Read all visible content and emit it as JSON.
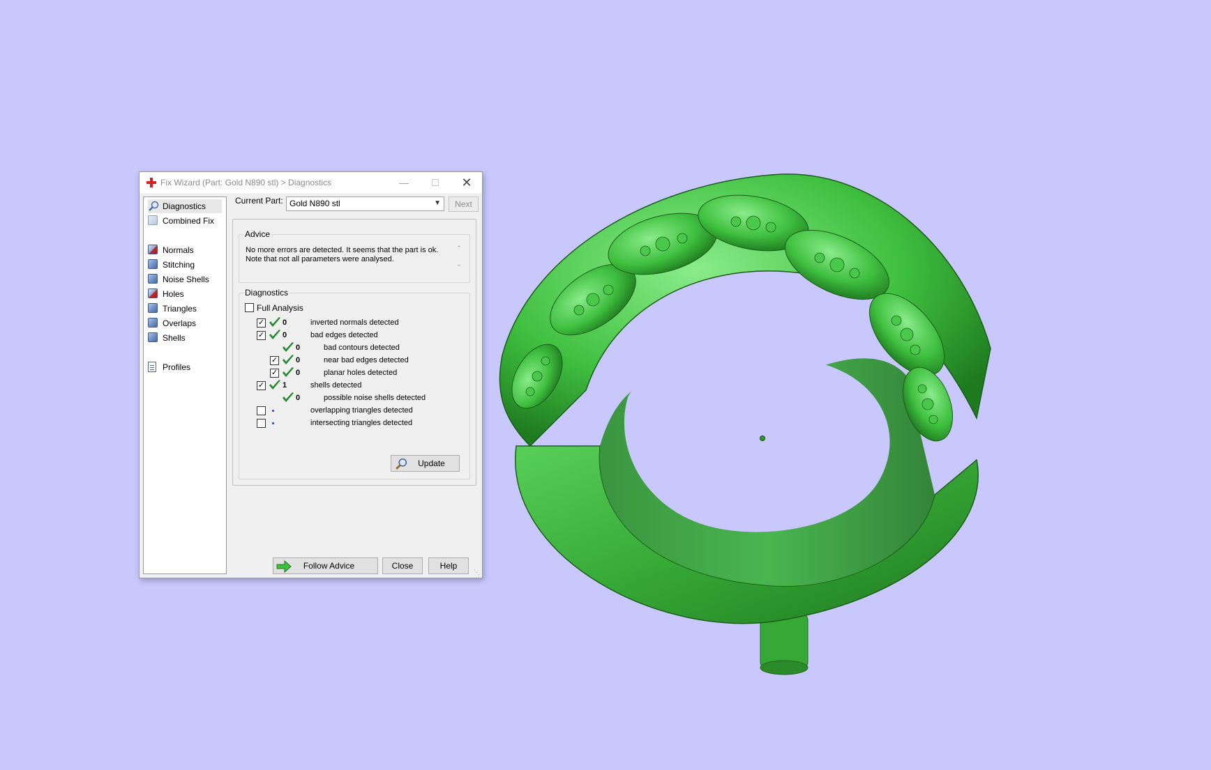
{
  "window": {
    "title": "Fix Wizard (Part: Gold N890 stl) > Diagnostics",
    "min_glyph": "—",
    "close_glyph": "✕"
  },
  "nav": {
    "top": [
      {
        "label": "Diagnostics",
        "icon": "magnifier-icon",
        "selected": true
      },
      {
        "label": "Combined Fix",
        "icon": "combined-fix-icon"
      }
    ],
    "tools": [
      {
        "label": "Normals",
        "icon": "normals-icon"
      },
      {
        "label": "Stitching",
        "icon": "stitching-icon"
      },
      {
        "label": "Noise Shells",
        "icon": "noise-shells-icon"
      },
      {
        "label": "Holes",
        "icon": "holes-icon"
      },
      {
        "label": "Triangles",
        "icon": "triangles-icon"
      },
      {
        "label": "Overlaps",
        "icon": "overlaps-icon"
      },
      {
        "label": "Shells",
        "icon": "shells-icon"
      }
    ],
    "bottom": [
      {
        "label": "Profiles",
        "icon": "profiles-icon"
      }
    ]
  },
  "current_part": {
    "label": "Current Part:",
    "value": "Gold N890 stl",
    "next_label": "Next"
  },
  "advice": {
    "title": "Advice",
    "line1": "No more errors are detected. It seems that the part is ok.",
    "line2": "Note that not all parameters were analysed."
  },
  "diagnostics": {
    "title": "Diagnostics",
    "full_analysis_label": "Full Analysis",
    "full_analysis_checked": false,
    "rows": [
      {
        "checked": true,
        "status": "ok",
        "count": "0",
        "label": "inverted normals detected",
        "indent": 0
      },
      {
        "checked": true,
        "status": "ok",
        "count": "0",
        "label": "bad edges detected",
        "indent": 0
      },
      {
        "checked": null,
        "status": "ok",
        "count": "0",
        "label": "bad contours detected",
        "indent": 1
      },
      {
        "checked": true,
        "status": "ok",
        "count": "0",
        "label": "near bad edges detected",
        "indent": 1
      },
      {
        "checked": true,
        "status": "ok",
        "count": "0",
        "label": "planar holes detected",
        "indent": 1
      },
      {
        "checked": true,
        "status": "ok",
        "count": "1",
        "label": "shells detected",
        "indent": 0
      },
      {
        "checked": null,
        "status": "ok",
        "count": "0",
        "label": "possible noise shells detected",
        "indent": 1
      },
      {
        "checked": false,
        "status": "none",
        "count": "",
        "label": "overlapping triangles detected",
        "indent": 0
      },
      {
        "checked": false,
        "status": "none",
        "count": "",
        "label": "intersecting triangles detected",
        "indent": 0
      }
    ],
    "update_label": "Update"
  },
  "footer": {
    "follow_advice_label": "Follow Advice",
    "close_label": "Close",
    "help_label": "Help"
  },
  "colors": {
    "background": "#c8c8fc",
    "model_green": "#3fb83f",
    "check_green": "#1f8a2c"
  }
}
